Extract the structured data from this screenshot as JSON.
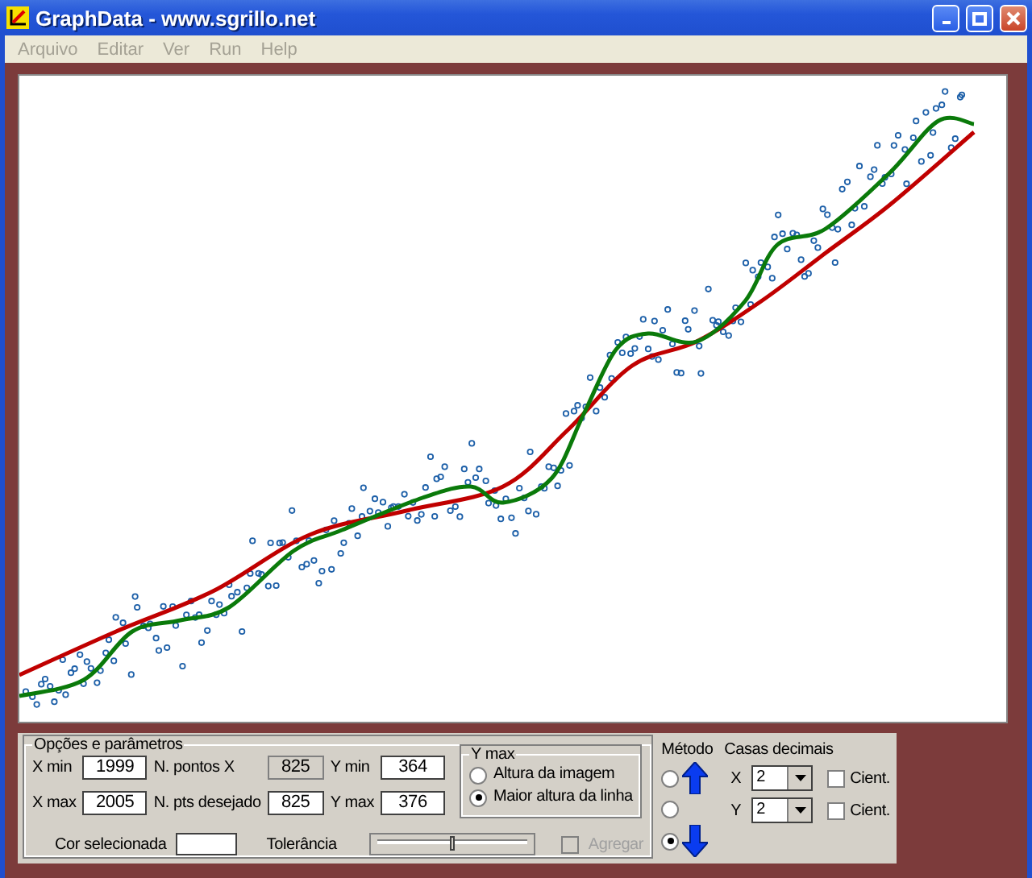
{
  "window": {
    "title": "GraphData - www.sgrillo.net"
  },
  "menu": [
    {
      "label": "Arquivo",
      "disabled": true
    },
    {
      "label": "Editar",
      "disabled": true
    },
    {
      "label": "Ver",
      "disabled": true
    },
    {
      "label": "Run",
      "disabled": true
    },
    {
      "label": "Help",
      "disabled": true
    }
  ],
  "options": {
    "title": "Opções e parâmetros",
    "fields": [
      {
        "label": "X min",
        "value": "1999",
        "disabled": false
      },
      {
        "label": "N. pontos X",
        "value": "825",
        "disabled": true
      },
      {
        "label": "Y min",
        "value": "364",
        "disabled": false
      },
      {
        "label": "X max",
        "value": "2005",
        "disabled": false
      },
      {
        "label": "N. pts desejado",
        "value": "825",
        "disabled": false
      },
      {
        "label": "Y max",
        "value": "376",
        "disabled": false
      }
    ],
    "ymax": {
      "title": "Y max",
      "options": [
        {
          "label": "Altura da imagem",
          "selected": false
        },
        {
          "label": "Maior altura da linha",
          "selected": true
        }
      ]
    },
    "color_label": "Cor selecionada",
    "tolerance": {
      "label": "Tolerância",
      "level": 0.5
    },
    "aggregate": {
      "label": "Agregar",
      "checked": false,
      "disabled": true
    },
    "method": {
      "title": "Método",
      "options": [
        {
          "kind": "up",
          "selected": false
        },
        {
          "kind": "none",
          "selected": false
        },
        {
          "kind": "down",
          "selected": true
        }
      ]
    },
    "decimals": {
      "title": "Casas decimais",
      "rows": [
        {
          "axis": "X",
          "value": "2",
          "cient": "Cient.",
          "checked": false
        },
        {
          "axis": "Y",
          "value": "2",
          "cient": "Cient.",
          "checked": false
        }
      ]
    }
  }
}
